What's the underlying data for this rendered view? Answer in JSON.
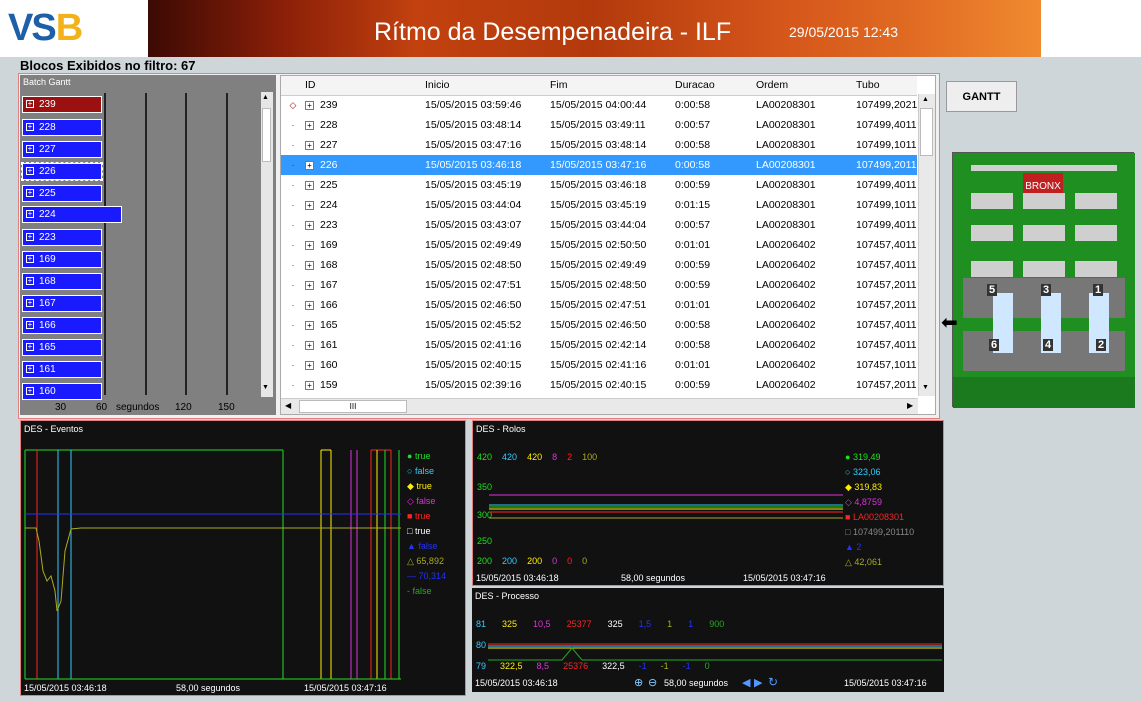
{
  "header": {
    "logo": "VS",
    "logo_b": "B",
    "title": "Rítmo da Desempenadeira - ILF",
    "datetime": "29/05/2015 12:43"
  },
  "filter_label": "Blocos Exibidos no filtro: 67",
  "gantt": {
    "label": "Batch Gantt",
    "axis": [
      "30",
      "60",
      "segundos",
      "120",
      "150"
    ],
    "bars": [
      {
        "id": "239",
        "red": true
      },
      {
        "id": "228"
      },
      {
        "id": "227"
      },
      {
        "id": "226",
        "sel": true
      },
      {
        "id": "225"
      },
      {
        "id": "224",
        "wide": true
      },
      {
        "id": "223"
      },
      {
        "id": "169"
      },
      {
        "id": "168"
      },
      {
        "id": "167"
      },
      {
        "id": "166"
      },
      {
        "id": "165"
      },
      {
        "id": "161"
      },
      {
        "id": "160"
      }
    ]
  },
  "table": {
    "columns": [
      "ID",
      "Inicio",
      "Fim",
      "Duracao",
      "Ordem",
      "Tubo"
    ],
    "rows": [
      [
        "239",
        "15/05/2015 03:59:46",
        "15/05/2015 04:00:44",
        "0:00:58",
        "LA00208301",
        "107499,2021"
      ],
      [
        "228",
        "15/05/2015 03:48:14",
        "15/05/2015 03:49:11",
        "0:00:57",
        "LA00208301",
        "107499,4011"
      ],
      [
        "227",
        "15/05/2015 03:47:16",
        "15/05/2015 03:48:14",
        "0:00:58",
        "LA00208301",
        "107499,1011"
      ],
      [
        "226",
        "15/05/2015 03:46:18",
        "15/05/2015 03:47:16",
        "0:00:58",
        "LA00208301",
        "107499,2011"
      ],
      [
        "225",
        "15/05/2015 03:45:19",
        "15/05/2015 03:46:18",
        "0:00:59",
        "LA00208301",
        "107499,4011"
      ],
      [
        "224",
        "15/05/2015 03:44:04",
        "15/05/2015 03:45:19",
        "0:01:15",
        "LA00208301",
        "107499,1011"
      ],
      [
        "223",
        "15/05/2015 03:43:07",
        "15/05/2015 03:44:04",
        "0:00:57",
        "LA00208301",
        "107499,4011"
      ],
      [
        "169",
        "15/05/2015 02:49:49",
        "15/05/2015 02:50:50",
        "0:01:01",
        "LA00206402",
        "107457,4011"
      ],
      [
        "168",
        "15/05/2015 02:48:50",
        "15/05/2015 02:49:49",
        "0:00:59",
        "LA00206402",
        "107457,4011"
      ],
      [
        "167",
        "15/05/2015 02:47:51",
        "15/05/2015 02:48:50",
        "0:00:59",
        "LA00206402",
        "107457,2011"
      ],
      [
        "166",
        "15/05/2015 02:46:50",
        "15/05/2015 02:47:51",
        "0:01:01",
        "LA00206402",
        "107457,2011"
      ],
      [
        "165",
        "15/05/2015 02:45:52",
        "15/05/2015 02:46:50",
        "0:00:58",
        "LA00206402",
        "107457,4011"
      ],
      [
        "161",
        "15/05/2015 02:41:16",
        "15/05/2015 02:42:14",
        "0:00:58",
        "LA00206402",
        "107457,4011"
      ],
      [
        "160",
        "15/05/2015 02:40:15",
        "15/05/2015 02:41:16",
        "0:01:01",
        "LA00206402",
        "107457,1011"
      ],
      [
        "159",
        "15/05/2015 02:39:16",
        "15/05/2015 02:40:15",
        "0:00:59",
        "LA00206402",
        "107457,2011"
      ]
    ],
    "selected_index": 3,
    "scroll_label": "III"
  },
  "gantt_button": "GANTT",
  "machine": {
    "rolls": [
      "5",
      "3",
      "1",
      "6",
      "4",
      "2"
    ],
    "logo": "BRONX",
    "gauge": "0.0"
  },
  "eventos": {
    "label": "DES - Eventos",
    "legend": [
      {
        "t": "true",
        "c": "#22dd22",
        "m": "●"
      },
      {
        "t": "false",
        "c": "#33ccff",
        "m": "○"
      },
      {
        "t": "true",
        "c": "#ffee00",
        "m": "◆"
      },
      {
        "t": "false",
        "c": "#dd33dd",
        "m": "◇"
      },
      {
        "t": "true",
        "c": "#ff2222",
        "m": "■"
      },
      {
        "t": "true",
        "c": "#ffffff",
        "m": "□"
      },
      {
        "t": "false",
        "c": "#2233ff",
        "m": "▲"
      },
      {
        "t": "65,892",
        "c": "#aaaa22",
        "m": "△"
      },
      {
        "t": "70,314",
        "c": "#2233ff",
        "m": "—"
      },
      {
        "t": "false",
        "c": "#22aa22",
        "m": "-"
      }
    ],
    "start": "15/05/2015 03:46:18",
    "span": "58,00 segundos",
    "end": "15/05/2015 03:47:16"
  },
  "rolos": {
    "label": "DES - Rolos",
    "top": [
      {
        "t": "420",
        "c": "#22dd22"
      },
      {
        "t": "420",
        "c": "#33ccff"
      },
      {
        "t": "420",
        "c": "#ffee00"
      },
      {
        "t": "8",
        "c": "#dd33dd"
      },
      {
        "t": "2",
        "c": "#ff2222"
      },
      {
        "t": "100",
        "c": "#aaaa22"
      }
    ],
    "yl": [
      "350",
      "300",
      "250"
    ],
    "bottom": [
      {
        "t": "200",
        "c": "#22dd22"
      },
      {
        "t": "200",
        "c": "#33ccff"
      },
      {
        "t": "200",
        "c": "#ffee00"
      },
      {
        "t": "0",
        "c": "#dd33dd"
      },
      {
        "t": "0",
        "c": "#ff2222"
      },
      {
        "t": "0",
        "c": "#aaaa22"
      }
    ],
    "legend": [
      {
        "t": "319,49",
        "c": "#22dd22",
        "m": "●"
      },
      {
        "t": "323,06",
        "c": "#33ccff",
        "m": "○"
      },
      {
        "t": "319,83",
        "c": "#ffee00",
        "m": "◆"
      },
      {
        "t": "4,8759",
        "c": "#dd33dd",
        "m": "◇"
      },
      {
        "t": "LA00208301",
        "c": "#ff2222",
        "m": "■"
      },
      {
        "t": "107499,201110",
        "c": "#888888",
        "m": "□"
      },
      {
        "t": "2",
        "c": "#2233ff",
        "m": "▲"
      },
      {
        "t": "42,061",
        "c": "#aaaa22",
        "m": "△"
      }
    ],
    "start": "15/05/2015 03:46:18",
    "span": "58,00 segundos",
    "end": "15/05/2015 03:47:16"
  },
  "processo": {
    "label": "DES - Processo",
    "top": [
      {
        "t": "81",
        "c": "#33ccff"
      },
      {
        "t": "325",
        "c": "#ffee00"
      },
      {
        "t": "10,5",
        "c": "#dd33dd"
      },
      {
        "t": "25377",
        "c": "#ff2222"
      },
      {
        "t": "325",
        "c": "#ffffff"
      },
      {
        "t": "1,5",
        "c": "#2233ff"
      },
      {
        "t": "1",
        "c": "#aaaa22"
      },
      {
        "t": "1",
        "c": "#2233ff"
      },
      {
        "t": "900",
        "c": "#22aa22"
      }
    ],
    "mid": "80",
    "bottom": [
      {
        "t": "79",
        "c": "#33ccff"
      },
      {
        "t": "322,5",
        "c": "#ffee00"
      },
      {
        "t": "8,5",
        "c": "#dd33dd"
      },
      {
        "t": "25376",
        "c": "#ff2222"
      },
      {
        "t": "322,5",
        "c": "#ffffff"
      },
      {
        "t": "-1",
        "c": "#2233ff"
      },
      {
        "t": "-1",
        "c": "#aaaa22"
      },
      {
        "t": "-1",
        "c": "#2233ff"
      },
      {
        "t": "0",
        "c": "#22aa22"
      }
    ],
    "start": "15/05/2015 03:46:18",
    "span": "58,00 segundos",
    "end": "15/05/2015 03:47:16"
  }
}
